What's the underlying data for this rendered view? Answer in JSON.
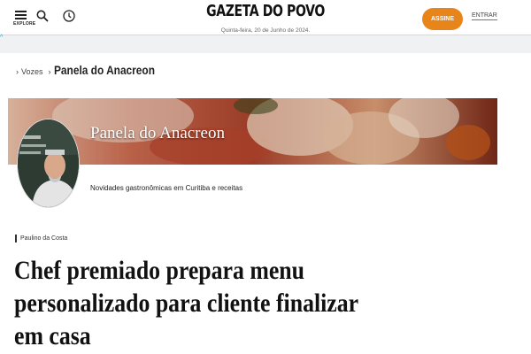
{
  "header": {
    "explore_label": "EXPLORE",
    "logo_text": "GAZETA DO POVO",
    "date_text": "Quinta-feira, 20 de Junho de 2024.",
    "subscribe_label": "ASSINE",
    "login_label": "ENTRAR",
    "accent_color": "#e8851a",
    "ad_marker": "^"
  },
  "icons": {
    "menu": "hamburger-icon",
    "search": "search-icon",
    "clock": "clock-icon"
  },
  "breadcrumb": {
    "separator": "›",
    "items": [
      "Vozes",
      "Panela do Anacreon"
    ]
  },
  "column": {
    "title": "Panela do Anacreon",
    "tagline": "Novidades gastronômicas em Curitiba e receitas"
  },
  "article": {
    "author": "Paulino da Costa",
    "headline": "Chef premiado prepara menu personalizado para cliente finalizar em casa"
  }
}
